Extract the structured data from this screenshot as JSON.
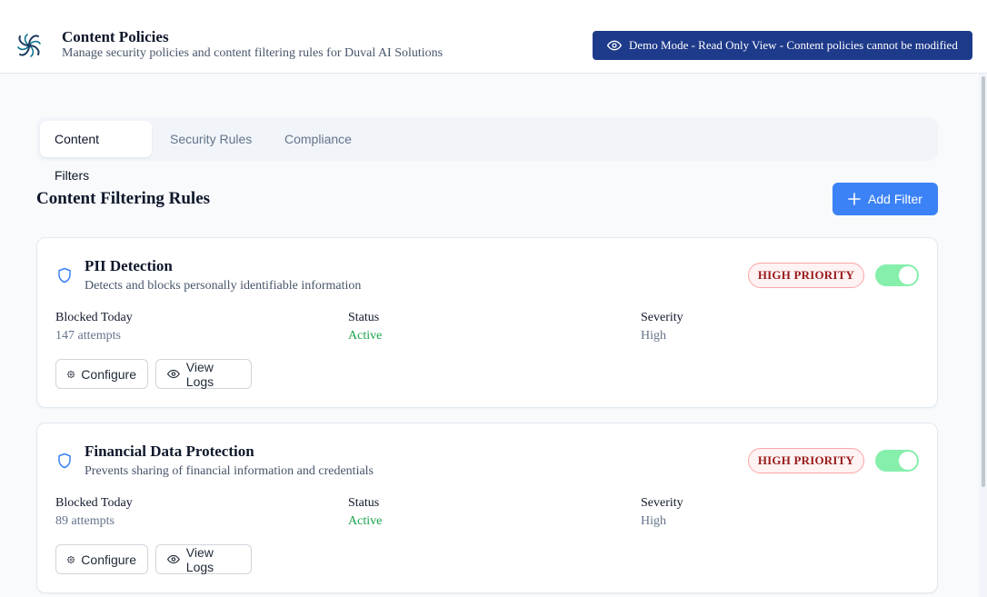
{
  "header": {
    "title": "Content Policies",
    "subtitle": "Manage security policies and content filtering rules for Duval AI Solutions",
    "demo_banner": "Demo Mode - Read Only View - Content policies cannot be modified"
  },
  "tabs": [
    {
      "label": "Content Filters",
      "active": true
    },
    {
      "label": "Security Rules",
      "active": false
    },
    {
      "label": "Compliance",
      "active": false
    }
  ],
  "section": {
    "title": "Content Filtering Rules",
    "add_button": "Add Filter"
  },
  "stat_labels": {
    "blocked": "Blocked Today",
    "status": "Status",
    "severity": "Severity"
  },
  "buttons": {
    "configure": "Configure",
    "view_logs": "View Logs"
  },
  "filters": [
    {
      "title": "PII Detection",
      "description": "Detects and blocks personally identifiable information",
      "priority": "HIGH PRIORITY",
      "enabled": true,
      "blocked": "147 attempts",
      "status": "Active",
      "severity": "High"
    },
    {
      "title": "Financial Data Protection",
      "description": "Prevents sharing of financial information and credentials",
      "priority": "HIGH PRIORITY",
      "enabled": true,
      "blocked": "89 attempts",
      "status": "Active",
      "severity": "High"
    }
  ],
  "colors": {
    "accent": "#3b82f6",
    "banner": "#1e3a8a",
    "active_status": "#16a34a",
    "toggle_on": "#86efac",
    "priority_text": "#991b1b"
  },
  "icons": {
    "logo": "swirl-logo-icon",
    "banner": "eye-icon",
    "filter": "shield-icon",
    "add": "plus-icon",
    "configure": "gear-icon",
    "view_logs": "eye-icon"
  }
}
